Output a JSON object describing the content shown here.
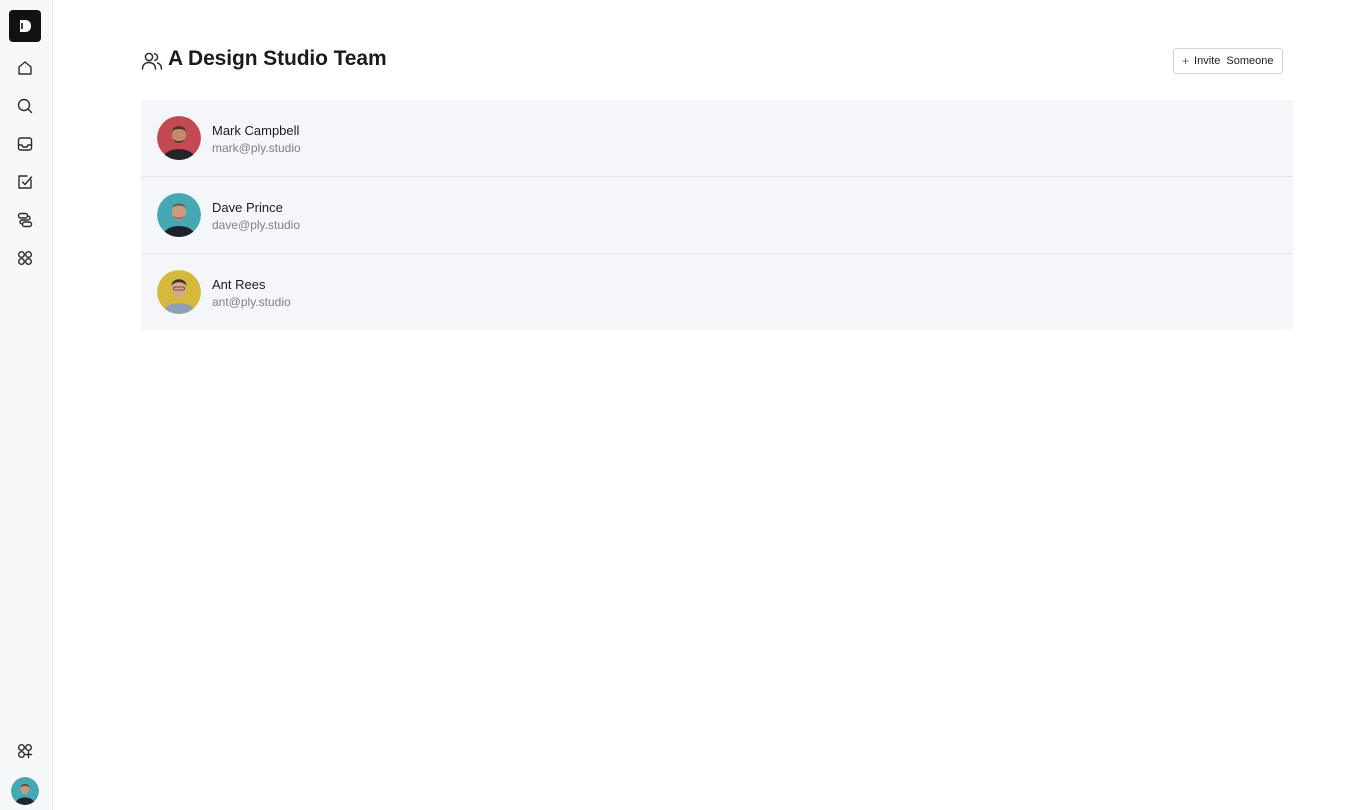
{
  "sidebar": {
    "logo": {
      "icon": "app-logo-icon",
      "letter": "D"
    },
    "nav": [
      {
        "icon": "home-icon"
      },
      {
        "icon": "search-icon"
      },
      {
        "icon": "inbox-icon"
      },
      {
        "icon": "tasks-checkbox-icon"
      },
      {
        "icon": "workflow-icon"
      },
      {
        "icon": "apps-grid-icon"
      }
    ],
    "bottom": [
      {
        "icon": "add-app-icon"
      },
      {
        "icon": "user-avatar"
      }
    ]
  },
  "header": {
    "icon": "team-users-icon",
    "title": "A Design Studio Team",
    "invite_button": {
      "icon": "plus-icon",
      "plus": "+",
      "label": "Invite Someone"
    }
  },
  "members": [
    {
      "name": "Mark Campbell",
      "email": "mark@ply.studio",
      "avatar_bg": "#c44a52"
    },
    {
      "name": "Dave Prince",
      "email": "dave@ply.studio",
      "avatar_bg": "#45a9b3"
    },
    {
      "name": "Ant Rees",
      "email": "ant@ply.studio",
      "avatar_bg": "#d6b83f"
    }
  ],
  "colors": {
    "sidebar_bg": "#f7f8fa",
    "list_bg": "#f4f6f9",
    "accent_dark": "#121214"
  }
}
